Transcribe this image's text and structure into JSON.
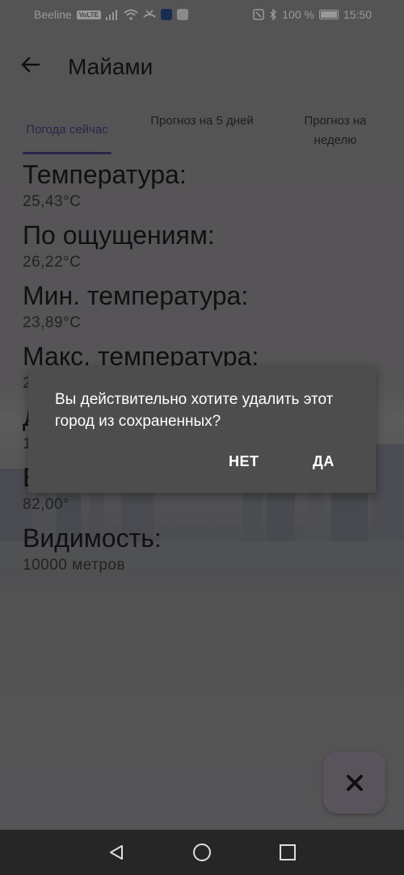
{
  "status_bar": {
    "carrier": "Beeline",
    "volte": "VoLTE",
    "battery": "100 %",
    "time": "15:50"
  },
  "appbar": {
    "title": "Майами"
  },
  "tabs": [
    {
      "label": "Погода сейчас",
      "active": true
    },
    {
      "label": "Прогноз на 5 дней",
      "active": false
    },
    {
      "label": "Прогноз на неделю",
      "active": false
    }
  ],
  "weather": [
    {
      "label": "Температура:",
      "value": "25,43°C"
    },
    {
      "label": "По ощущениям:",
      "value": "26,22°C"
    },
    {
      "label": "Мин. температура:",
      "value": "23,89°C"
    },
    {
      "label": "Макс. температура:",
      "value": "2"
    },
    {
      "label": "Д",
      "value": "1"
    },
    {
      "label": "В",
      "value": "82,00°"
    },
    {
      "label": "Видимость:",
      "value": "10000 метров"
    }
  ],
  "dialog": {
    "message": "Вы действительно хотите удалить этот город из сохраненных?",
    "no_label": "НЕТ",
    "yes_label": "ДА"
  },
  "colors": {
    "accent": "#4a3f79",
    "dialog_bg": "#4d4d4d",
    "fab_bg": "#958b99",
    "nav_bg": "#262626"
  }
}
